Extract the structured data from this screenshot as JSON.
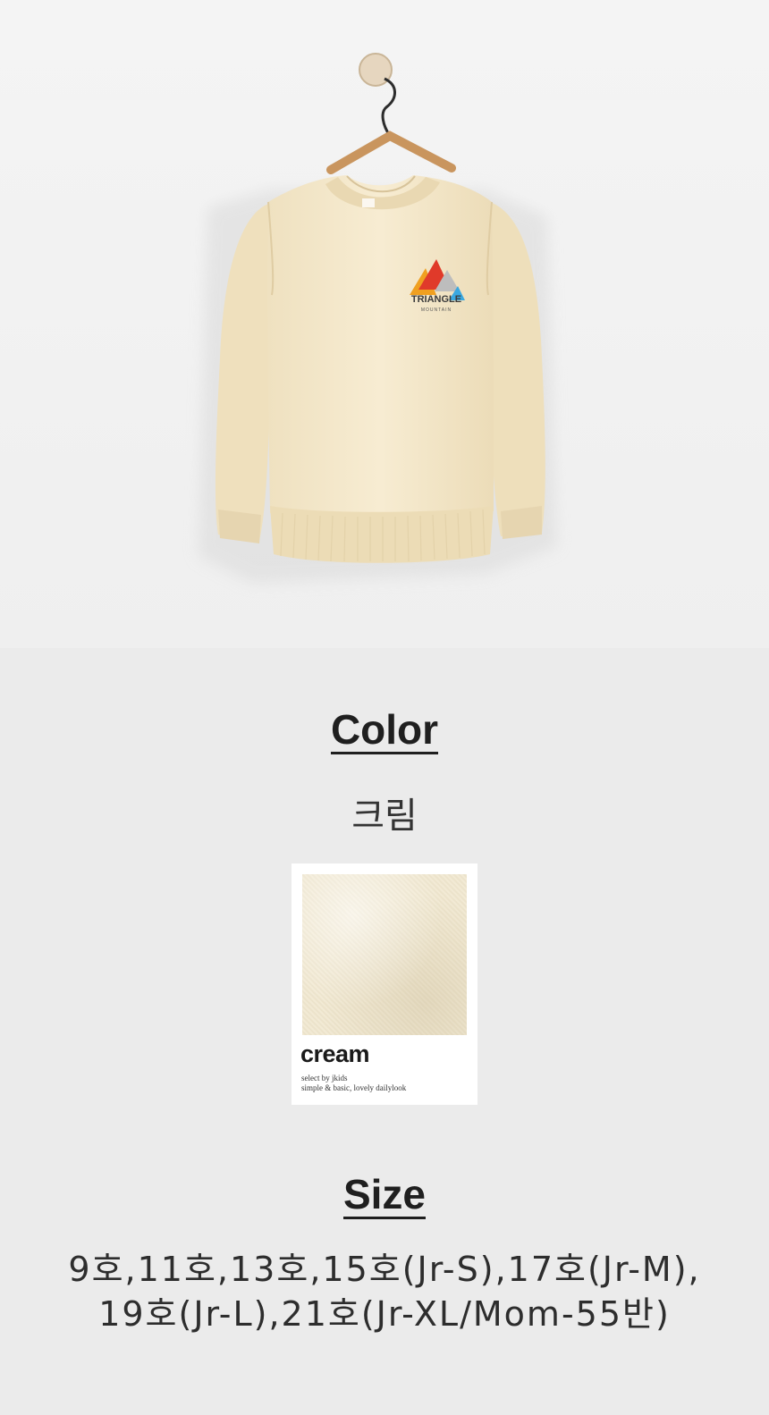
{
  "product_image": {
    "alt_icon": "sweatshirt-on-hanger",
    "logo_text_main": "TRIANGLE",
    "logo_text_sub": "MOUNTAIN",
    "colors": {
      "fabric": "#f3e8cc",
      "shadow": "#dccfae",
      "hanger": "#c9a27a",
      "logo_orange": "#f0a020",
      "logo_red": "#e03a2a",
      "logo_gray": "#bdbdbd",
      "logo_blue": "#3aa8e0"
    }
  },
  "color_section": {
    "heading": "Color",
    "name": "크림",
    "swatch": {
      "label": "cream",
      "sub_line1": "select by jkids",
      "sub_line2": "simple & basic, lovely dailylook"
    }
  },
  "size_section": {
    "heading": "Size",
    "line1": "9호,11호,13호,15호(Jr-S),17호(Jr-M),",
    "line2": "19호(Jr-L),21호(Jr-XL/Mom-55반)"
  }
}
